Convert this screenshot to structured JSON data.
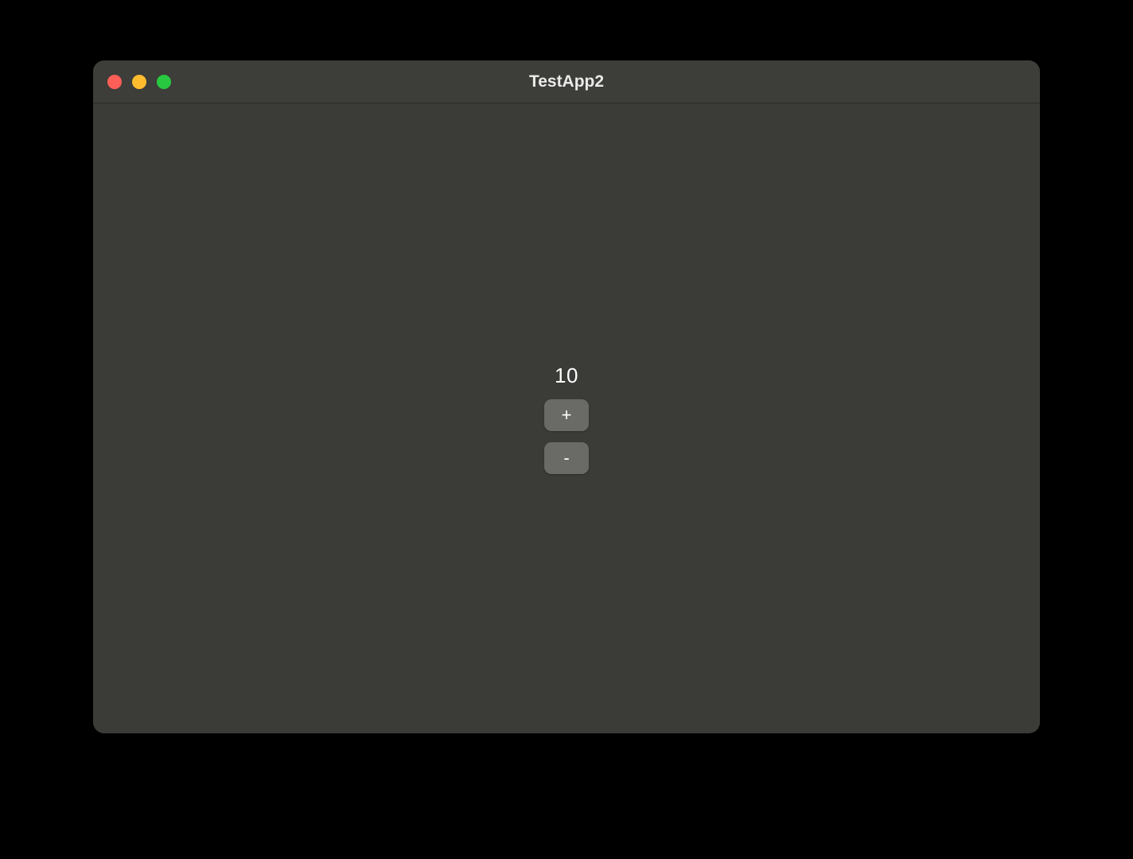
{
  "window": {
    "title": "TestApp2",
    "traffic_lights": {
      "close_color": "#ff5f57",
      "minimize_color": "#febc2e",
      "maximize_color": "#28c840"
    }
  },
  "counter": {
    "value": "10",
    "increment_label": "+",
    "decrement_label": "-"
  }
}
